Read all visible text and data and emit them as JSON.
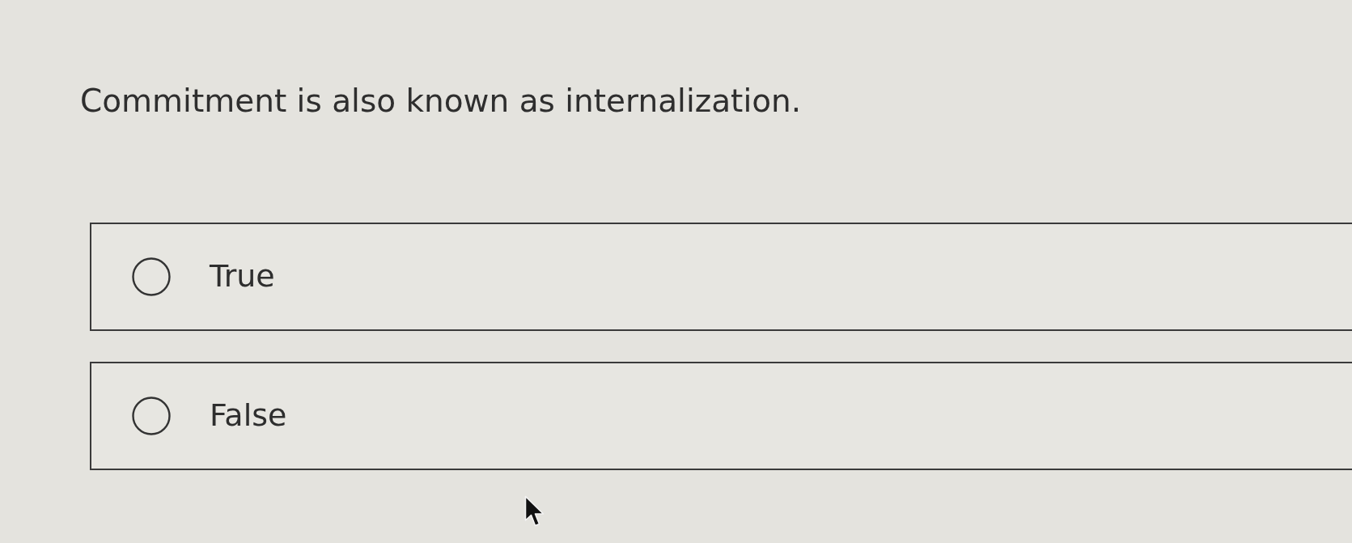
{
  "question": {
    "text": "Commitment is also known as internalization."
  },
  "options": [
    {
      "label": "True",
      "selected": false
    },
    {
      "label": "False",
      "selected": false
    }
  ]
}
